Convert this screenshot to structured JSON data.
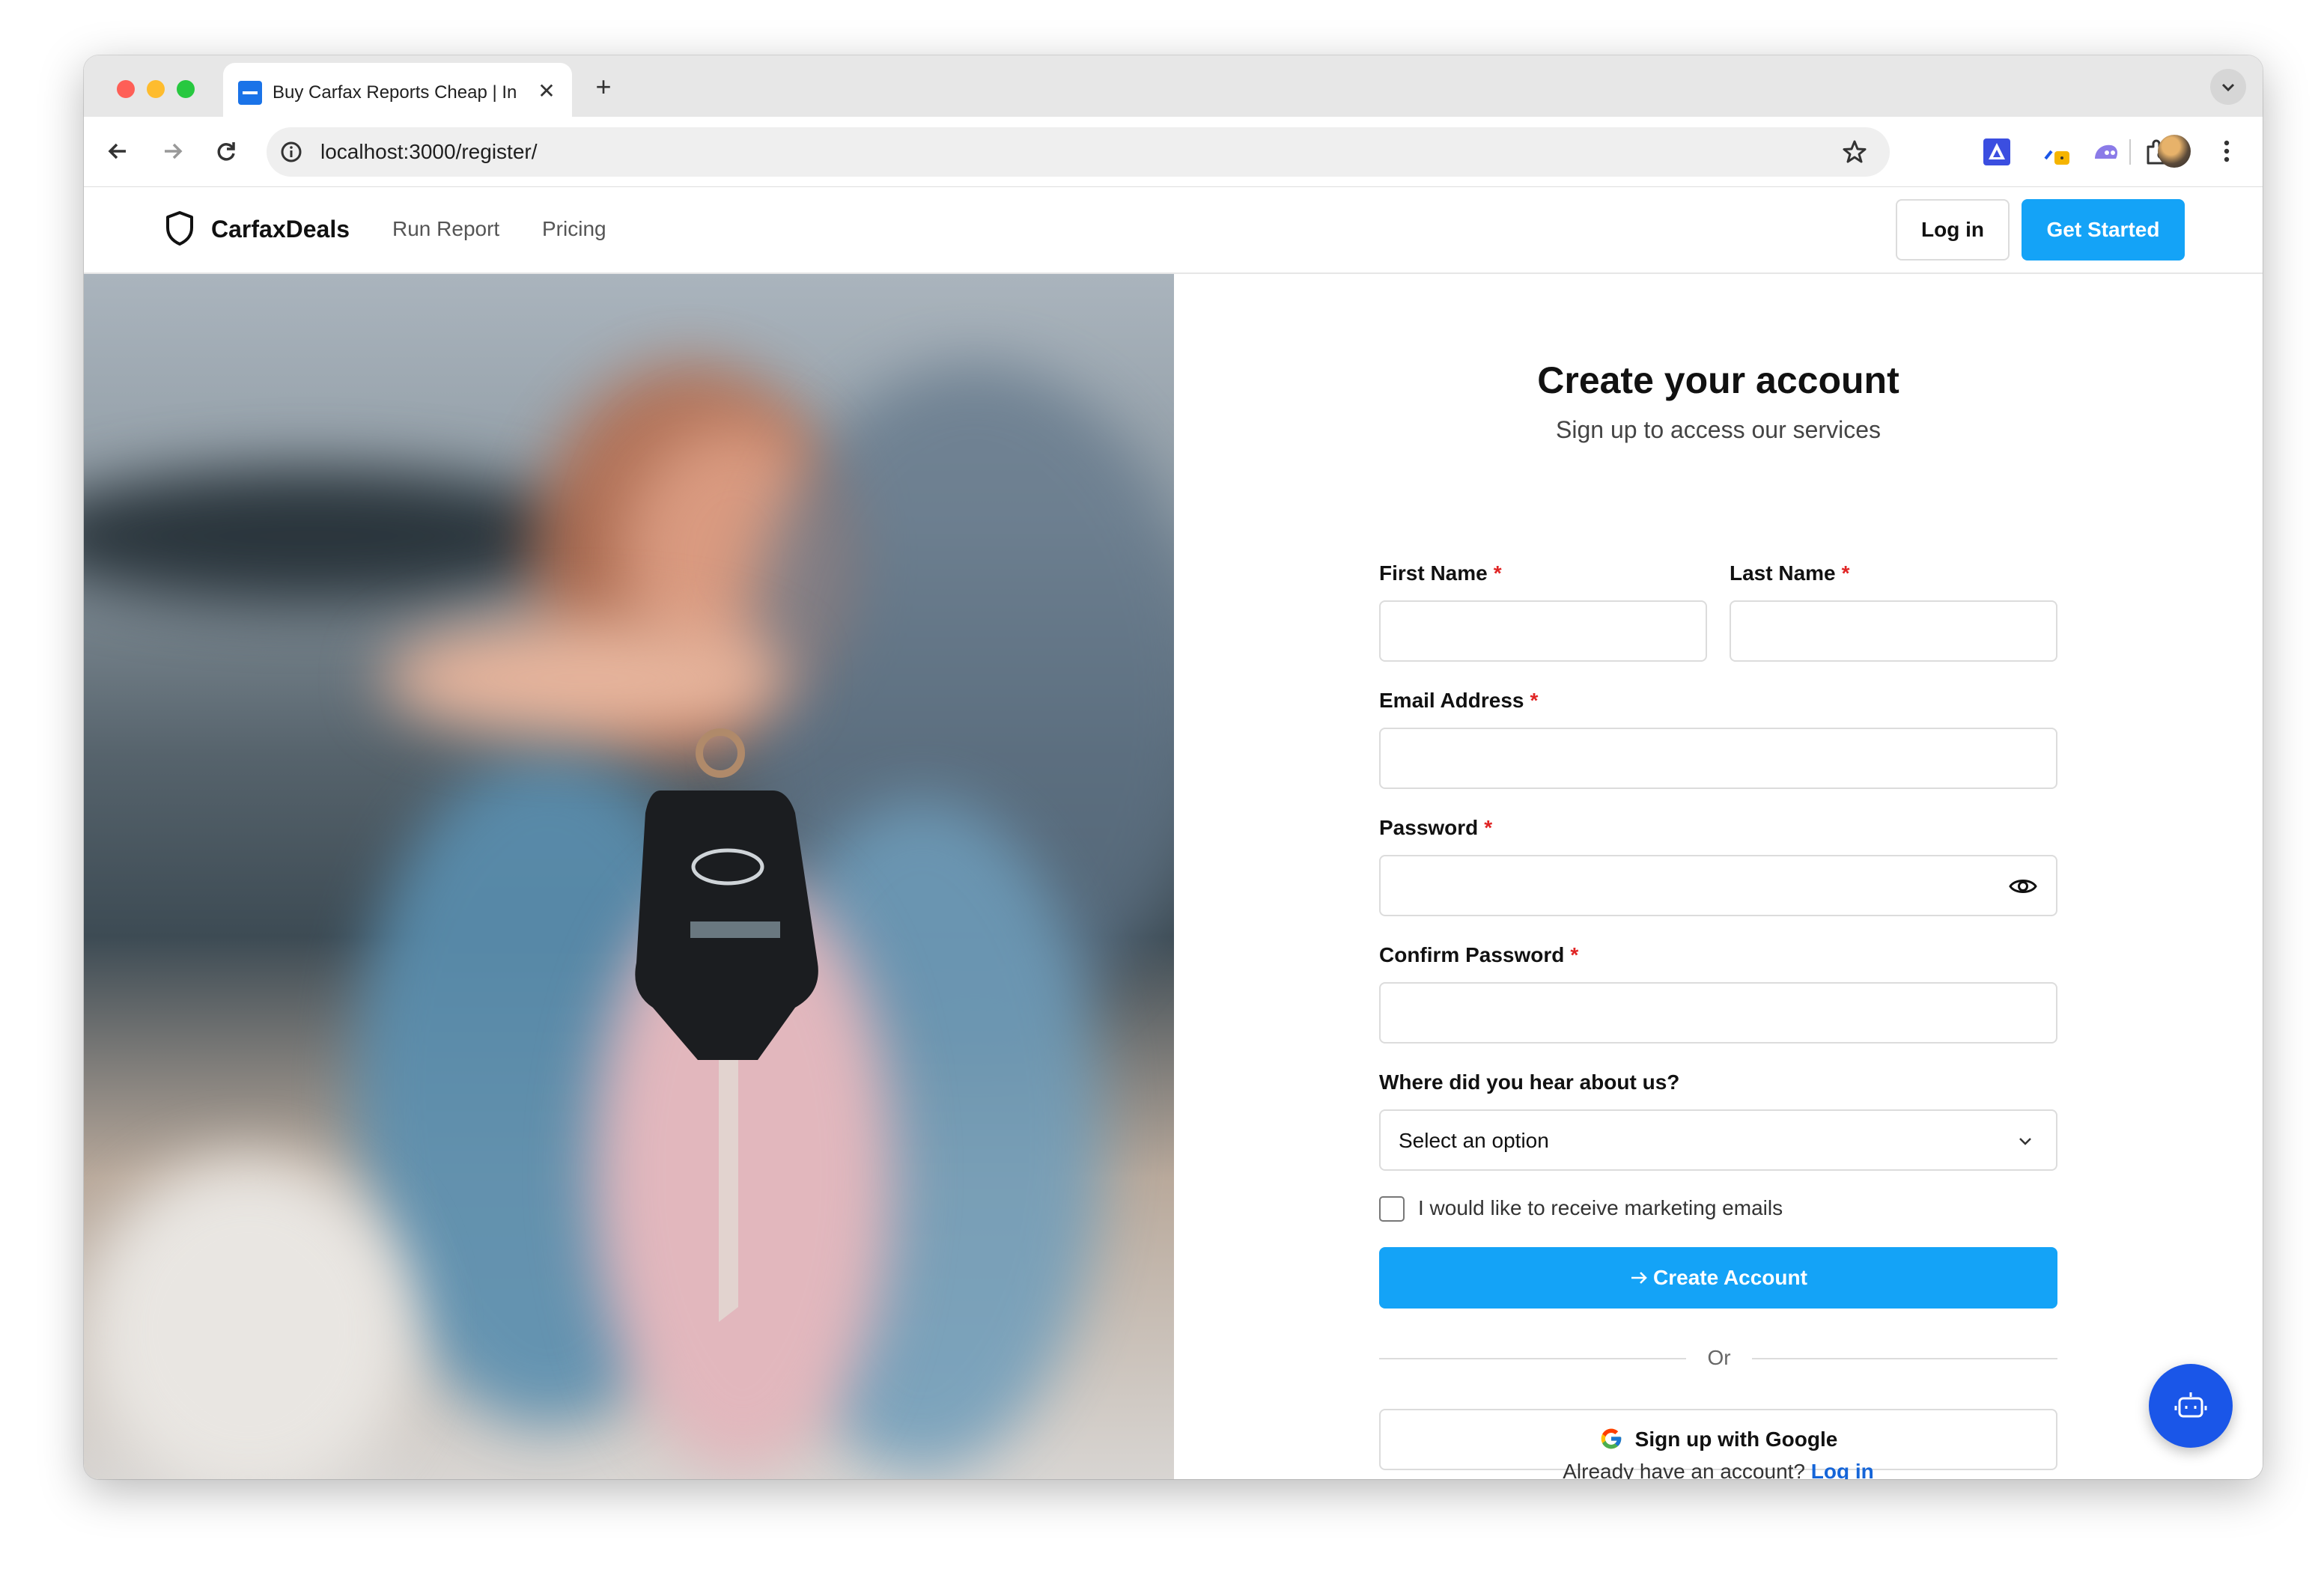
{
  "browser": {
    "tab_title": "Buy Carfax Reports Cheap | In",
    "url": "localhost:3000/register/"
  },
  "site": {
    "brand": "CarfaxDeals",
    "nav": [
      "Run Report",
      "Pricing"
    ],
    "login_label": "Log in",
    "cta_label": "Get Started"
  },
  "form": {
    "title": "Create your account",
    "subtitle": "Sign up to access our services",
    "first_name_label": "First Name",
    "last_name_label": "Last Name",
    "email_label": "Email Address",
    "password_label": "Password",
    "confirm_label": "Confirm Password",
    "required_mark": "*",
    "referral_label": "Where did you hear about us?",
    "referral_selected": "Select an option",
    "marketing_label": "I would like to receive marketing emails",
    "submit_label": "Create Account",
    "divider_text": "Or",
    "google_label": "Sign up with Google",
    "login_prompt": "Already have an account?",
    "login_link": "Log in"
  },
  "colors": {
    "primary": "#14a3f7",
    "link": "#1565d8",
    "required": "#e02424",
    "fab": "#1a56e8"
  },
  "icons": {
    "brand": "shield-icon",
    "password_toggle": "eye-icon",
    "select": "chevron-down-icon",
    "submit": "arrow-right-icon",
    "google": "google-icon",
    "fab": "robot-icon"
  }
}
